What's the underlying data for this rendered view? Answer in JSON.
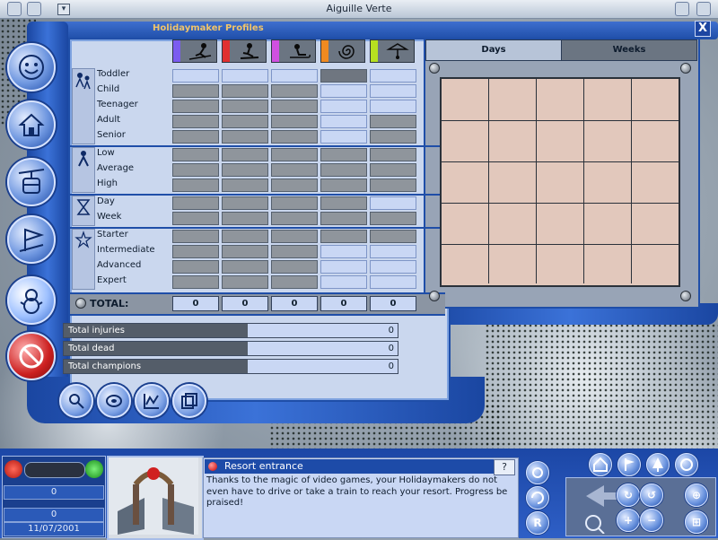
{
  "window": {
    "title": "Aiguille Verte"
  },
  "dialog": {
    "title": "Holidaymaker Profiles",
    "close_label": "X"
  },
  "colors": {
    "accent": "#1f4ea8",
    "title_text": "#f0c46a",
    "grid_fill": "#e2c8bc",
    "col_swatches": [
      "#7b5cf0",
      "#e03030",
      "#d050e0",
      "#f08a20",
      "#b7e020"
    ]
  },
  "columns": [
    {
      "icon": "skier-icon",
      "color": "#7b5cf0"
    },
    {
      "icon": "snowboarder-icon",
      "color": "#e03030"
    },
    {
      "icon": "sledder-icon",
      "color": "#d050e0"
    },
    {
      "icon": "spiral-icon",
      "color": "#f08a20"
    },
    {
      "icon": "hang-glider-icon",
      "color": "#b7e020"
    }
  ],
  "groups": [
    {
      "icon": "family-icon",
      "rows": [
        {
          "label": "Toddler",
          "cells": [
            "on",
            "on",
            "on",
            "dark",
            "on"
          ]
        },
        {
          "label": "Child",
          "cells": [
            "off",
            "off",
            "off",
            "on",
            "on"
          ]
        },
        {
          "label": "Teenager",
          "cells": [
            "off",
            "off",
            "off",
            "on",
            "on"
          ]
        },
        {
          "label": "Adult",
          "cells": [
            "off",
            "off",
            "off",
            "on",
            "off"
          ]
        },
        {
          "label": "Senior",
          "cells": [
            "off",
            "off",
            "off",
            "on",
            "off"
          ]
        }
      ]
    },
    {
      "icon": "wealth-icon",
      "rows": [
        {
          "label": "Low",
          "cells": [
            "off",
            "off",
            "off",
            "off",
            "off"
          ]
        },
        {
          "label": "Average",
          "cells": [
            "off",
            "off",
            "off",
            "off",
            "off"
          ]
        },
        {
          "label": "High",
          "cells": [
            "off",
            "off",
            "off",
            "off",
            "off"
          ]
        }
      ]
    },
    {
      "icon": "hourglass-icon",
      "rows": [
        {
          "label": "Day",
          "cells": [
            "off",
            "off",
            "off",
            "off",
            "on"
          ]
        },
        {
          "label": "Week",
          "cells": [
            "off",
            "off",
            "off",
            "off",
            "off"
          ]
        }
      ]
    },
    {
      "icon": "stars-icon",
      "rows": [
        {
          "label": "Starter",
          "cells": [
            "off",
            "off",
            "off",
            "off",
            "off"
          ]
        },
        {
          "label": "Intermediate",
          "cells": [
            "off",
            "off",
            "off",
            "on",
            "on"
          ]
        },
        {
          "label": "Advanced",
          "cells": [
            "off",
            "off",
            "off",
            "on",
            "on"
          ]
        },
        {
          "label": "Expert",
          "cells": [
            "off",
            "off",
            "off",
            "on",
            "on"
          ]
        }
      ]
    }
  ],
  "totals": {
    "label": "TOTAL:",
    "values": [
      "0",
      "0",
      "0",
      "0",
      "0"
    ]
  },
  "stats": [
    {
      "label": "Total injuries",
      "value": "0"
    },
    {
      "label": "Total dead",
      "value": "0"
    },
    {
      "label": "Total champions",
      "value": "0"
    }
  ],
  "tabs": {
    "days": "Days",
    "weeks": "Weeks"
  },
  "side_buttons": [
    "smiley-icon",
    "house-icon",
    "cable-car-icon",
    "flag-icon",
    "snowman-icon",
    "no-entry-icon"
  ],
  "tool_buttons": [
    "search-icon",
    "coin-icon",
    "graph-icon",
    "pages-icon"
  ],
  "hud": {
    "counter": "0",
    "money": "0",
    "date": "11/07/2001"
  },
  "info": {
    "title": "Resort entrance",
    "help": "?",
    "text": "Thanks to the magic of video games, your Holidaymakers do not even have to drive or take a train to reach your resort. Progress be praised!"
  },
  "side_small_buttons": [
    "R"
  ]
}
